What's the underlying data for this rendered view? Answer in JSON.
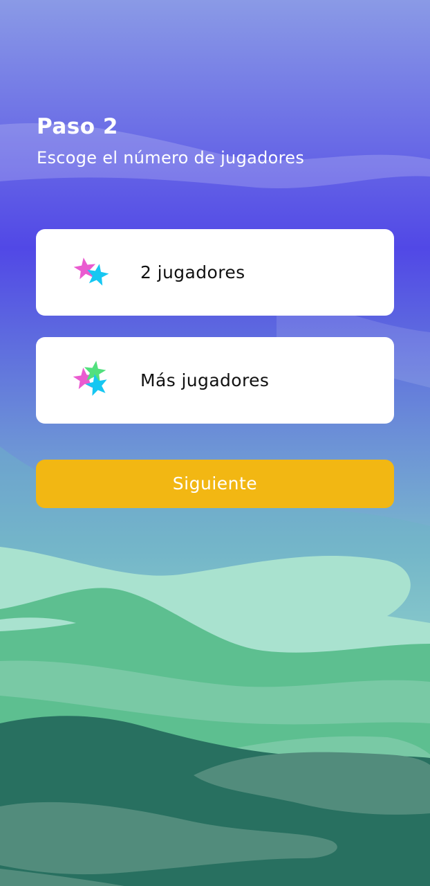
{
  "header": {
    "title": "Paso 2",
    "subtitle": "Escoge el número de jugadores"
  },
  "options": [
    {
      "label": "2 jugadores",
      "icon": "two-stars-icon"
    },
    {
      "label": "Más jugadores",
      "icon": "three-stars-icon"
    }
  ],
  "actions": {
    "next_label": "Siguiente"
  },
  "colors": {
    "sky_top": "#8a9ae6",
    "sky_mid": "#5148e6",
    "sky_low": "#6a8cd8",
    "mint": "#a6e2cf",
    "green_mid": "#5dbf90",
    "green_dark": "#287060",
    "card": "#ffffff",
    "button": "#f2b713",
    "star_pink": "#ea5bd0",
    "star_blue": "#16c7f2",
    "star_green": "#52e07e"
  }
}
